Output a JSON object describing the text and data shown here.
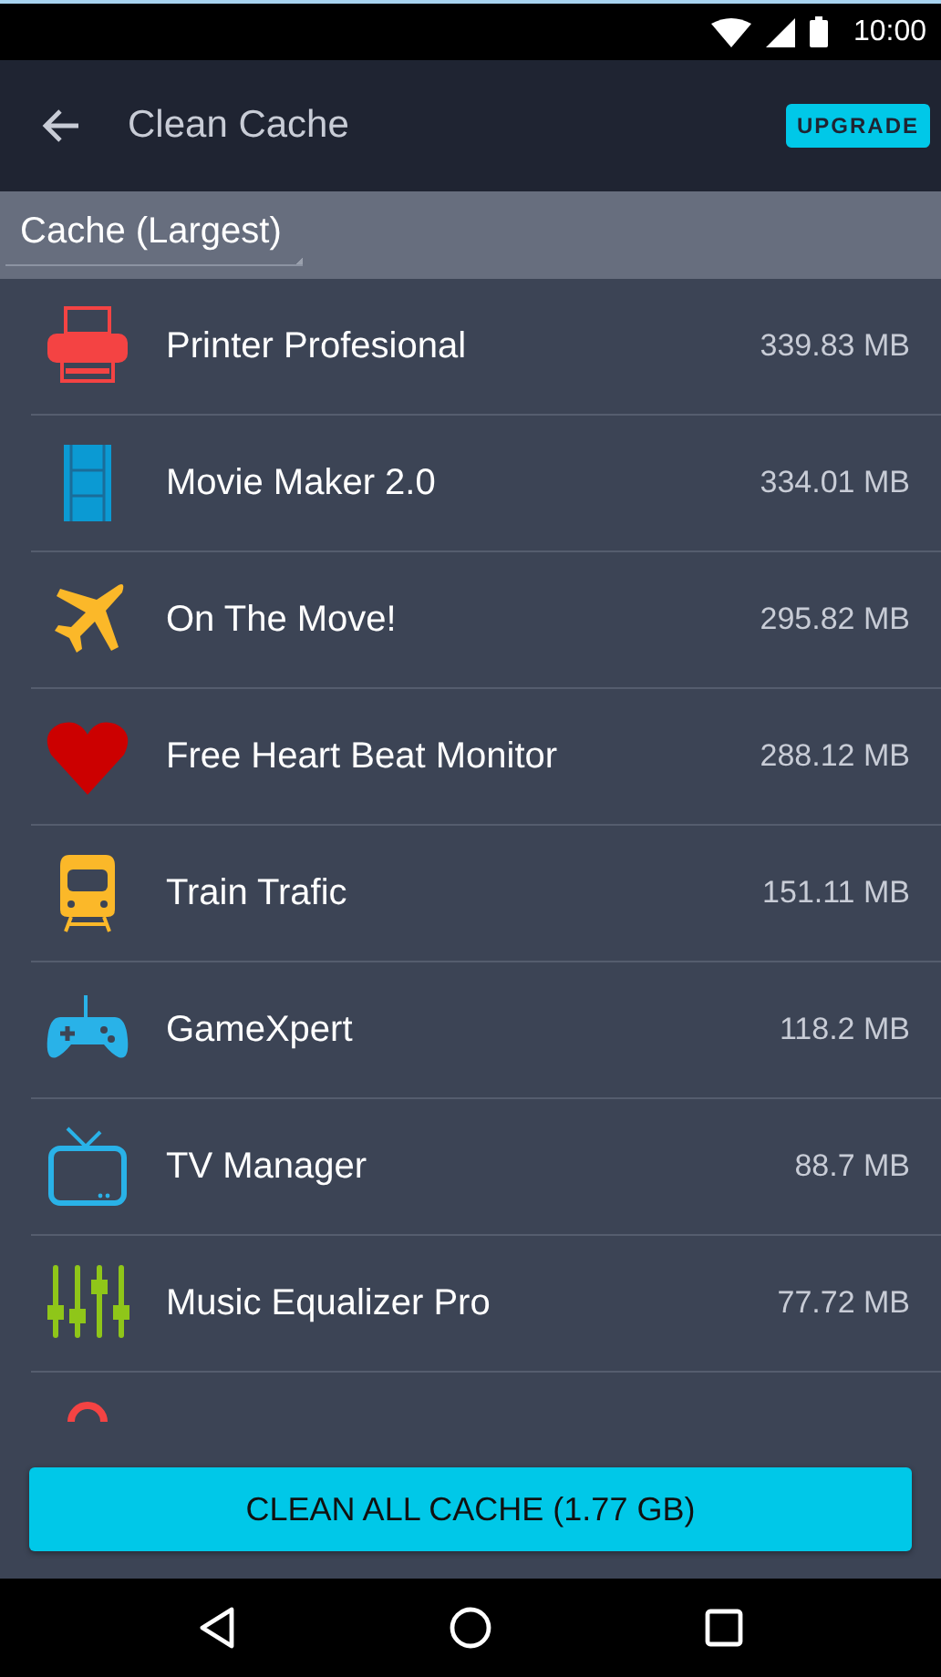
{
  "status_bar": {
    "time": "10:00"
  },
  "app_bar": {
    "title": "Clean Cache",
    "badge": "UPGRADE"
  },
  "sort": {
    "label": "Cache (Largest)"
  },
  "apps": [
    {
      "name": "Printer Profesional",
      "size": "339.83 MB",
      "kind": "printer",
      "color": "#f44343"
    },
    {
      "name": "Movie Maker 2.0",
      "size": "334.01 MB",
      "kind": "film",
      "color": "#0b9ad3"
    },
    {
      "name": "On The Move!",
      "size": "295.82 MB",
      "kind": "plane",
      "color": "#fbb829"
    },
    {
      "name": "Free Heart Beat Monitor",
      "size": "288.12 MB",
      "kind": "heart",
      "color": "#cc0000"
    },
    {
      "name": "Train Trafic",
      "size": "151.11 MB",
      "kind": "train",
      "color": "#fbb829"
    },
    {
      "name": "GameXpert",
      "size": "118.2 MB",
      "kind": "gamepad",
      "color": "#29b2e8"
    },
    {
      "name": "TV Manager",
      "size": "88.7 MB",
      "kind": "tv",
      "color": "#29b2e8"
    },
    {
      "name": "Music Equalizer Pro",
      "size": "77.72 MB",
      "kind": "equalizer",
      "color": "#8fc619"
    },
    {
      "kind": "arc",
      "color": "#f44343"
    }
  ],
  "action": {
    "label": "CLEAN ALL CACHE (1.77 GB)"
  }
}
